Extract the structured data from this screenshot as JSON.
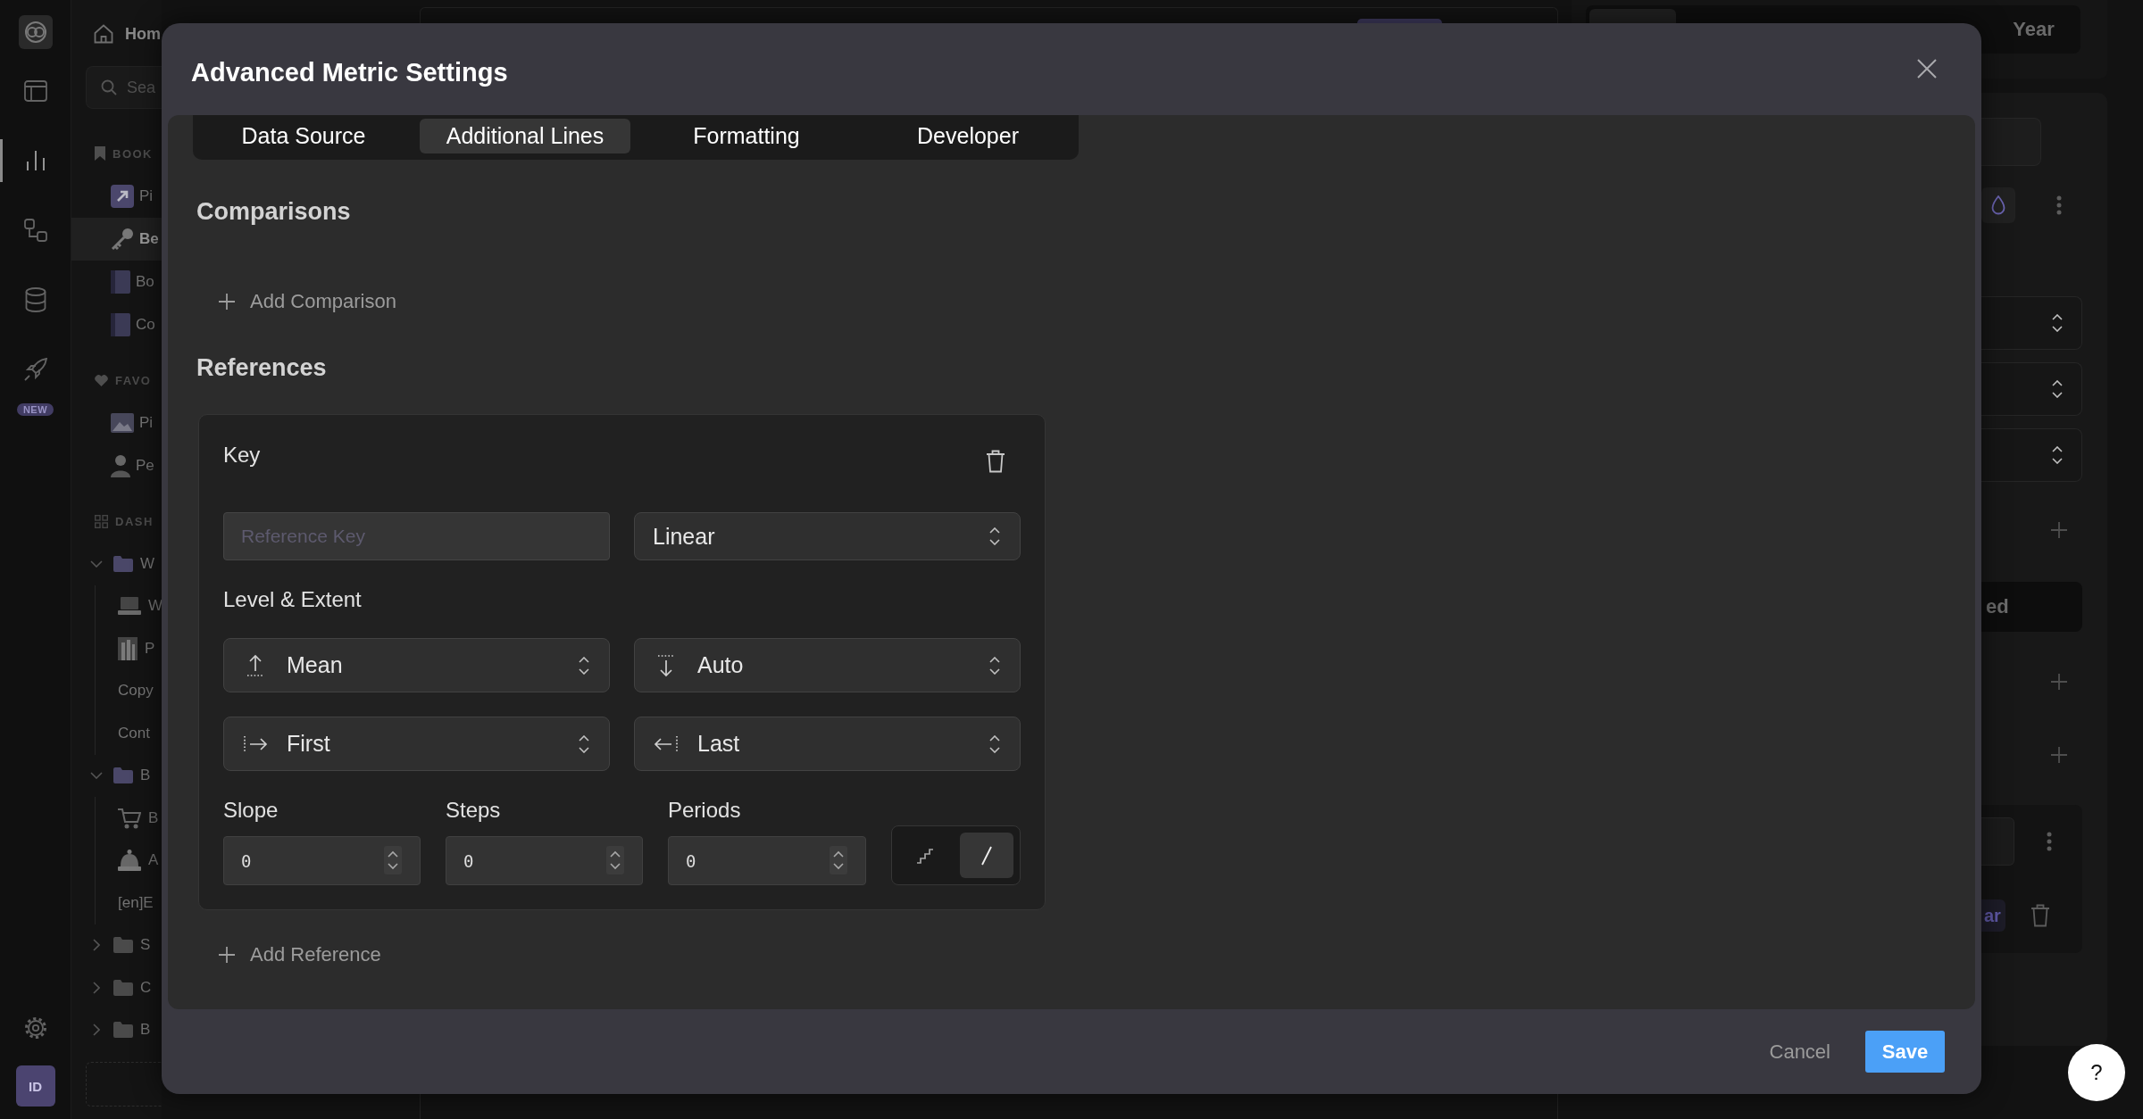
{
  "rail": {
    "items": [
      {
        "selected": false
      },
      {
        "selected": true
      },
      {
        "selected": false
      },
      {
        "selected": false
      },
      {
        "selected": false,
        "badge": "NEW"
      }
    ],
    "avatar": "ID"
  },
  "sidebar": {
    "home": "Hom",
    "search": {
      "placeholder": "Sea"
    },
    "bookmarks": {
      "title": "BOOK",
      "items": [
        {
          "label": "Pi",
          "selected": false
        },
        {
          "label": "Be",
          "selected": true
        },
        {
          "label": "Bo",
          "selected": false
        },
        {
          "label": "Co",
          "selected": false
        }
      ]
    },
    "favorites": {
      "title": "FAVO",
      "items": [
        {
          "label": "Pi",
          "selected": false
        },
        {
          "label": "Pe",
          "selected": false
        }
      ]
    },
    "dashboards": {
      "title": "DASH",
      "items": [
        {
          "label": "W",
          "selected": false,
          "expanded": true,
          "children": [
            {
              "label": "W",
              "selected": false
            },
            {
              "label": "P",
              "selected": false
            },
            {
              "label": "Copy",
              "selected": false
            },
            {
              "label": "Cont",
              "selected": false
            }
          ]
        },
        {
          "label": "B",
          "selected": false,
          "expanded": true,
          "children": [
            {
              "label": "B",
              "selected": false
            },
            {
              "label": "A",
              "selected": false
            },
            {
              "label": "[en]E",
              "selected": false
            }
          ]
        },
        {
          "label": "S",
          "selected": false,
          "expanded": false
        },
        {
          "label": "C",
          "selected": false,
          "expanded": false
        },
        {
          "label": "B",
          "selected": false,
          "expanded": false
        }
      ]
    }
  },
  "right_panel": {
    "period_options": [
      {
        "selected": true
      },
      {
        "label": "Year",
        "selected": false
      }
    ],
    "button_label": "ed",
    "card_button_label": "ar"
  },
  "dialog": {
    "title": "Advanced Metric Settings",
    "tabs": [
      {
        "label": "Data Source",
        "selected": false
      },
      {
        "label": "Additional Lines",
        "selected": true
      },
      {
        "label": "Formatting",
        "selected": false
      },
      {
        "label": "Developer",
        "selected": false
      }
    ],
    "comparisons": {
      "title": "Comparisons",
      "add_label": "Add Comparison"
    },
    "references": {
      "title": "References",
      "items": [
        {
          "key_label": "Key",
          "key_field": {
            "placeholder": "Reference Key"
          },
          "interpolation": "Linear",
          "extent_label": "Level & Extent",
          "level_select": "Mean",
          "extent_select": "Auto",
          "start_select": "First",
          "end_select": "Last",
          "slope": {
            "label": "Slope",
            "value": "0"
          },
          "steps": {
            "label": "Steps",
            "value": "0"
          },
          "periods": {
            "label": "Periods",
            "value": "0"
          },
          "line_styles": [
            {
              "kind": "step",
              "selected": false
            },
            {
              "kind": "straight",
              "selected": true
            }
          ]
        }
      ],
      "add_label": "Add Reference"
    },
    "buttons": [
      {
        "label": "Cancel",
        "kind": "secondary"
      },
      {
        "label": "Save",
        "kind": "primary"
      }
    ]
  },
  "help_button": {
    "label": "?"
  }
}
